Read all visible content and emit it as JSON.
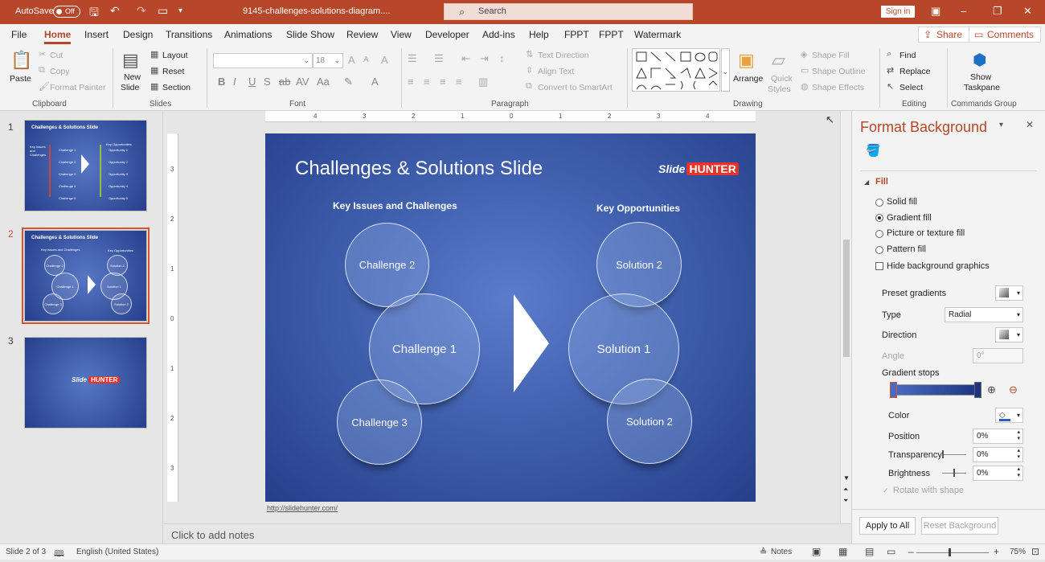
{
  "titlebar": {
    "autosave_label": "AutoSave",
    "autosave_state": "Off",
    "filename": "9145-challenges-solutions-diagram....",
    "search_placeholder": "Search",
    "signin": "Sign in"
  },
  "tabs": [
    "File",
    "Home",
    "Insert",
    "Design",
    "Transitions",
    "Animations",
    "Slide Show",
    "Review",
    "View",
    "Developer",
    "Add-ins",
    "Help",
    "FPPT",
    "FPPT",
    "Watermark"
  ],
  "active_tab": "Home",
  "share_label": "Share",
  "comments_label": "Comments",
  "ribbon": {
    "clipboard": {
      "paste": "Paste",
      "cut": "Cut",
      "copy": "Copy",
      "format_painter": "Format Painter",
      "label": "Clipboard"
    },
    "slides": {
      "new_slide_1": "New",
      "new_slide_2": "Slide",
      "layout": "Layout",
      "reset": "Reset",
      "section": "Section",
      "label": "Slides"
    },
    "font": {
      "size": "18",
      "label": "Font",
      "bold": "B",
      "italic": "I",
      "underline": "U",
      "strike": "S",
      "aa": "Aa",
      "a": "A"
    },
    "paragraph": {
      "text_direction": "Text Direction",
      "align_text": "Align Text",
      "convert_smartart": "Convert to SmartArt",
      "label": "Paragraph"
    },
    "drawing": {
      "arrange": "Arrange",
      "quick_styles_1": "Quick",
      "quick_styles_2": "Styles",
      "shape_fill": "Shape Fill",
      "shape_outline": "Shape Outline",
      "shape_effects": "Shape Effects",
      "label": "Drawing"
    },
    "editing": {
      "find": "Find",
      "replace": "Replace",
      "select": "Select",
      "label": "Editing"
    },
    "commands": {
      "show_1": "Show",
      "show_2": "Taskpane",
      "label": "Commands Group"
    }
  },
  "thumbnails": [
    {
      "num": "1",
      "title": "Challenges & Solutions Slide"
    },
    {
      "num": "2",
      "title": "Challenges & Solutions Slide",
      "selected": true
    },
    {
      "num": "3",
      "title": ""
    }
  ],
  "ruler": {
    "h": [
      "4",
      "3",
      "2",
      "1",
      "0",
      "1",
      "2",
      "3",
      "4"
    ],
    "v": [
      "3",
      "2",
      "1",
      "0",
      "1",
      "2",
      "3"
    ]
  },
  "slide": {
    "title": "Challenges & Solutions Slide",
    "logo_slide": "Slide",
    "logo_hunter": "HUNTER",
    "left_heading": "Key Issues and Challenges",
    "right_heading": "Key Opportunities",
    "challenges": [
      "Challenge 2",
      "Challenge 1",
      "Challenge 3"
    ],
    "solutions": [
      "Solution 2",
      "Solution 1",
      "Solution 2"
    ],
    "url": "http://slidehunter.com/"
  },
  "thumb1": {
    "left": "Key Issues and Challenges",
    "right": "Key Opportunities",
    "items_l": [
      "Challenge 1",
      "Challenge 2",
      "Challenge 3",
      "Challenge 4",
      "Challenge 5"
    ],
    "items_r": [
      "Opportunity 1",
      "Opportunity 2",
      "Opportunity 3",
      "Opportunity 4",
      "Opportunity 5"
    ]
  },
  "thumb2": {
    "left": "Key Issues and Challenges",
    "right": "Key Opportunities",
    "c": [
      "Challenge 2",
      "Challenge 1",
      "Challenge 3"
    ],
    "s": [
      "Solution 2",
      "Solution 1",
      "Solution 2"
    ]
  },
  "notes_placeholder": "Click to add notes",
  "pane": {
    "title": "Format Background",
    "section": "Fill",
    "options": [
      "Solid fill",
      "Gradient fill",
      "Picture or texture fill",
      "Pattern fill"
    ],
    "selected_option": "Gradient fill",
    "hide_bg": "Hide background graphics",
    "preset": "Preset gradients",
    "type_label": "Type",
    "type_value": "Radial",
    "direction": "Direction",
    "angle_label": "Angle",
    "angle_value": "0°",
    "stops": "Gradient stops",
    "color": "Color",
    "position_label": "Position",
    "position_value": "0%",
    "transparency_label": "Transparency",
    "transparency_value": "0%",
    "brightness_label": "Brightness",
    "brightness_value": "0%",
    "rotate": "Rotate with shape",
    "apply_all": "Apply to All",
    "reset_bg": "Reset Background",
    "colors": {
      "stop_light": "#4a6cc0",
      "stop_dark": "#1d3580"
    }
  },
  "status": {
    "slide_of": "Slide 2 of 3",
    "language": "English (United States)",
    "notes": "Notes",
    "zoom": "75%"
  },
  "colors": {
    "accent": "#b7472a",
    "slide_light": "#5b7ccb",
    "slide_dark": "#263f8b"
  }
}
